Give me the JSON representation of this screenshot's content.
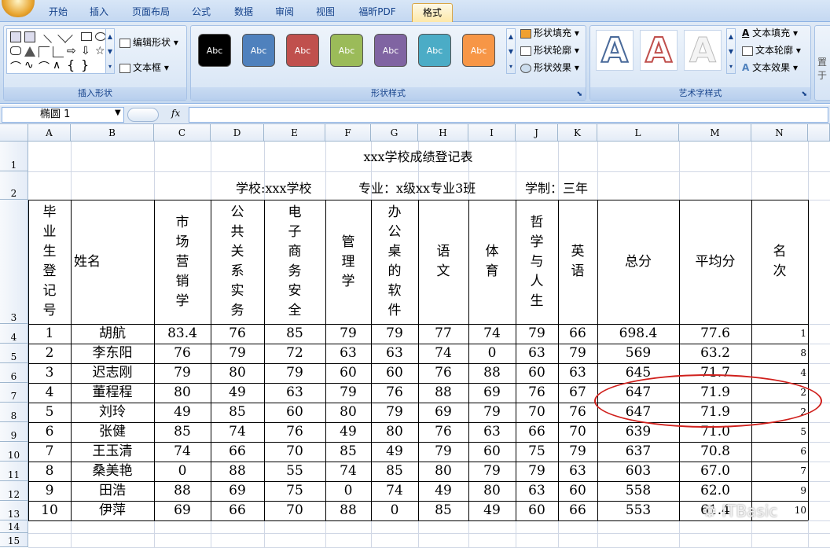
{
  "tabs": [
    "开始",
    "插入",
    "页面布局",
    "公式",
    "数据",
    "审阅",
    "视图",
    "福昕PDF",
    "格式"
  ],
  "ribbon": {
    "insert_shapes_label": "插入形状",
    "edit_shape": "编辑形状",
    "text_box": "文本框",
    "shape_styles_label": "形状样式",
    "style_text": "Abc",
    "shape_fill": "形状填充",
    "shape_outline": "形状轮廓",
    "shape_effect": "形状效果",
    "wordart_label": "艺术字样式",
    "text_fill": "文本填充",
    "text_outline": "文本轮廓",
    "text_effect": "文本效果",
    "cut_label": "置于",
    "style_colors": [
      "#000000",
      "#4f81bd",
      "#c0504d",
      "#9bbb59",
      "#8064a2",
      "#4bacc6",
      "#f79646"
    ]
  },
  "formula_bar": {
    "name_box": "椭圆 1",
    "fx": "fx"
  },
  "columns": [
    "A",
    "B",
    "C",
    "D",
    "E",
    "F",
    "G",
    "H",
    "I",
    "J",
    "K",
    "L",
    "M",
    "N"
  ],
  "rows": [
    "1",
    "2",
    "3",
    "4",
    "5",
    "6",
    "7",
    "8",
    "9",
    "10",
    "11",
    "12",
    "13",
    "14",
    "15"
  ],
  "sheet": {
    "title": "xxx学校成绩登记表",
    "school": "学校:xxx学校",
    "major": "专业：x级xx专业3班",
    "term": "学制：三年",
    "headers": [
      "毕业生登记号",
      "姓名",
      "市场营销学",
      "公共关系实务",
      "电子商务安全",
      "管理学",
      "办公桌的软件",
      "语文",
      "体育",
      "哲学与人生",
      "英语",
      "总分",
      "平均分",
      "名次"
    ],
    "data": [
      [
        "1",
        "胡航",
        "83.4",
        "76",
        "85",
        "79",
        "79",
        "77",
        "74",
        "79",
        "66",
        "698.4",
        "77.6",
        "1"
      ],
      [
        "2",
        "李东阳",
        "76",
        "79",
        "72",
        "63",
        "63",
        "74",
        "0",
        "63",
        "79",
        "569",
        "63.2",
        "8"
      ],
      [
        "3",
        "迟志刚",
        "79",
        "80",
        "79",
        "60",
        "60",
        "76",
        "88",
        "60",
        "63",
        "645",
        "71.7",
        "4"
      ],
      [
        "4",
        "董程程",
        "80",
        "49",
        "63",
        "79",
        "76",
        "88",
        "69",
        "76",
        "67",
        "647",
        "71.9",
        "2"
      ],
      [
        "5",
        "刘玲",
        "49",
        "85",
        "60",
        "80",
        "79",
        "69",
        "79",
        "70",
        "76",
        "647",
        "71.9",
        "2"
      ],
      [
        "6",
        "张健",
        "85",
        "74",
        "76",
        "49",
        "80",
        "76",
        "63",
        "66",
        "70",
        "639",
        "71.0",
        "5"
      ],
      [
        "7",
        "王玉清",
        "74",
        "66",
        "70",
        "85",
        "49",
        "79",
        "60",
        "75",
        "79",
        "637",
        "70.8",
        "6"
      ],
      [
        "8",
        "桑美艳",
        "0",
        "88",
        "55",
        "74",
        "85",
        "80",
        "79",
        "79",
        "63",
        "603",
        "67.0",
        "7"
      ],
      [
        "9",
        "田浩",
        "88",
        "69",
        "75",
        "0",
        "74",
        "49",
        "80",
        "63",
        "60",
        "558",
        "62.0",
        "9"
      ],
      [
        "10",
        "伊萍",
        "69",
        "66",
        "70",
        "88",
        "0",
        "85",
        "49",
        "60",
        "66",
        "553",
        "61.4",
        "10"
      ]
    ]
  },
  "watermark": "ITBasic"
}
